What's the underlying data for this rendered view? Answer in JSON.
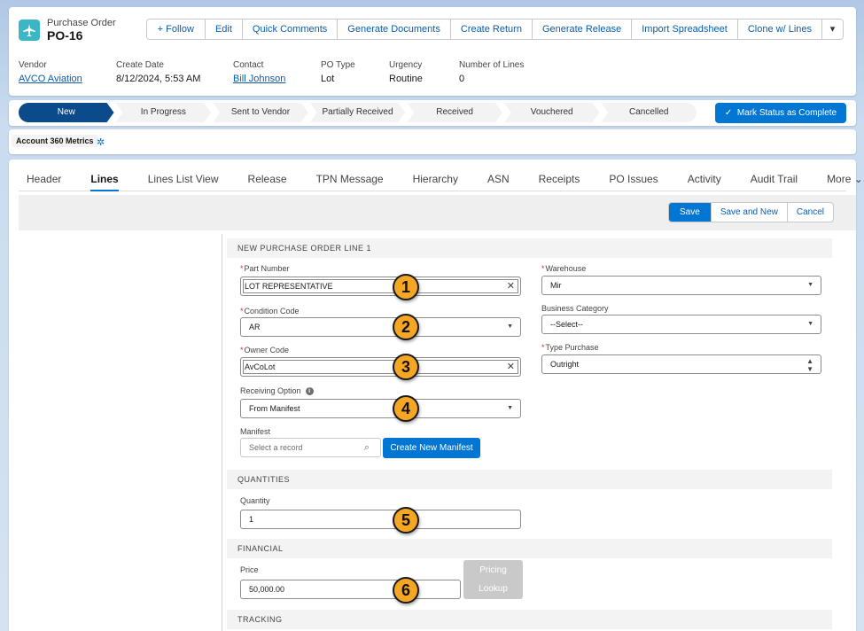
{
  "record": {
    "object_label": "Purchase Order",
    "title": "PO-16"
  },
  "actions": {
    "follow": "Follow",
    "edit": "Edit",
    "quick_comments": "Quick Comments",
    "generate_documents": "Generate Documents",
    "create_return": "Create Return",
    "generate_release": "Generate Release",
    "import_spreadsheet": "Import Spreadsheet",
    "clone_lines": "Clone w/ Lines"
  },
  "highlights": [
    {
      "label": "Vendor",
      "value": "AVCO Aviation"
    },
    {
      "label": "Create Date",
      "value": "8/12/2024, 5:53 AM"
    },
    {
      "label": "Contact",
      "value": "Bill Johnson"
    },
    {
      "label": "PO Type",
      "value": "Lot"
    },
    {
      "label": "Urgency",
      "value": "Routine"
    },
    {
      "label": "Number of Lines",
      "value": "0"
    }
  ],
  "path": {
    "stages": [
      "New",
      "In Progress",
      "Sent to Vendor",
      "Partially Received",
      "Received",
      "Vouchered",
      "Cancelled"
    ],
    "active": "New",
    "mark_button": "Mark Status as Complete"
  },
  "metrics": {
    "label": "Account 360 Metrics"
  },
  "tabs": [
    "Header",
    "Lines",
    "Lines List View",
    "Release",
    "TPN Message",
    "Hierarchy",
    "ASN",
    "Receipts",
    "PO Issues",
    "Activity",
    "Audit Trail"
  ],
  "tabs_more": "More",
  "active_tab": "Lines",
  "form_buttons": {
    "save": "Save",
    "save_new": "Save and New",
    "cancel": "Cancel"
  },
  "sections": {
    "new_line": "NEW PURCHASE ORDER LINE 1",
    "quantities": "QUANTITIES",
    "financial": "FINANCIAL",
    "tracking": "TRACKING"
  },
  "fields": {
    "part_number": {
      "label": "Part Number",
      "value": "LOT REPRESENTATIVE"
    },
    "condition_code": {
      "label": "Condition Code",
      "value": "AR"
    },
    "owner_code": {
      "label": "Owner Code",
      "value": "AvCoLot"
    },
    "receiving_option": {
      "label": "Receiving Option",
      "value": "From Manifest"
    },
    "manifest": {
      "label": "Manifest",
      "placeholder": "Select a record"
    },
    "warehouse": {
      "label": "Warehouse",
      "value": "Mir"
    },
    "business_category": {
      "label": "Business Category",
      "value": "--Select--"
    },
    "type_purchase": {
      "label": "Type Purchase",
      "value": "Outright"
    },
    "quantity": {
      "label": "Quantity",
      "value": "1"
    },
    "price": {
      "label": "Price",
      "value": "50,000.00"
    }
  },
  "create_manifest_button": "Create New Manifest",
  "pricing_lookup": {
    "line1": "Pricing",
    "line2": "Lookup"
  },
  "callouts": [
    "1",
    "2",
    "3",
    "4",
    "5",
    "6"
  ],
  "colors": {
    "brand": "#0176d3",
    "path_active": "#0b4a8b",
    "callout": "#f5a623",
    "required": "#c23934"
  }
}
